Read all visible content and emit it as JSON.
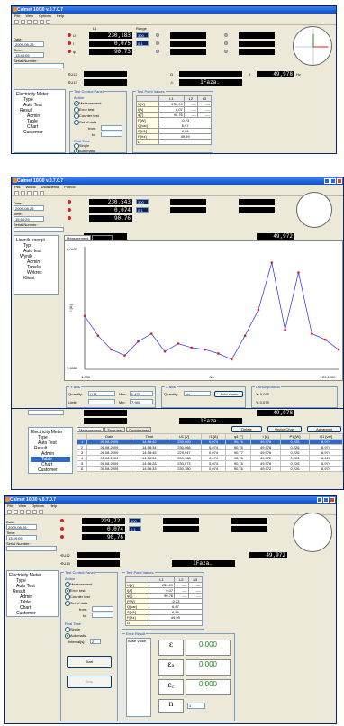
{
  "app": {
    "title": "Calmet 10/30 v.0.7.0.7",
    "menu": [
      "File",
      "View",
      "Options",
      "Help"
    ],
    "menu2": [
      "Plik",
      "Widok",
      "Ustawienia",
      "Pomoc"
    ]
  },
  "left_panel": {
    "date_label": "Date:",
    "date_value": "2009-08-26",
    "time_label": "Time:",
    "time_value": "13:49:05",
    "serial_label": "Serial Number:",
    "serial_value": ""
  },
  "shot2_left": {
    "date_value": "2009-08-26",
    "time_value": "15:54:29"
  },
  "shot4_left": {
    "date_value": "2009-08-26",
    "time_value": "13:49:05"
  },
  "readings1": {
    "range_label": "Range",
    "l1_label": "L1",
    "u_symbol": "U",
    "i_symbol": "I",
    "phi_symbol": "φ",
    "u_value": "230,183",
    "u_range": "300",
    "i_value": "0,075",
    "i_range": "0,1",
    "phi_value": "90,73",
    "phi_unit": "°",
    "u12_label": "∢U12",
    "u13_label": "∢U13",
    "mode_value": "1Faza.",
    "f_label": "f",
    "f_value": "49,978",
    "f_unit": "Hz"
  },
  "readings2": {
    "u_value": "230,543",
    "u_range": "300",
    "i_value": "0,074",
    "i_range": "0,1",
    "phi_value": "90,76",
    "f_value": "49,972"
  },
  "readings3": {
    "mode_value": "1Faza.",
    "f_value": "49,978"
  },
  "readings4": {
    "u_value": "229,721",
    "u_range": "300",
    "i_value": "0,074",
    "i_range": "0,1",
    "phi_value": "90,76",
    "f_value": "49,972",
    "mode_value": "1Faza."
  },
  "tree1": [
    "Electricity Meter",
    "Type",
    "Auto Test",
    "Result",
    "Admin",
    "Table",
    "Chart",
    "Customer"
  ],
  "tree2": [
    "Licznik energii",
    "Typ",
    "Auto test",
    "Wynik",
    "Admin",
    "Tabela",
    "Wykres",
    "Klient"
  ],
  "tree3": [
    "Electricity Meter",
    "Type",
    "Auto Test",
    "Result",
    "Admin",
    "Table",
    "Chart",
    "Customer"
  ],
  "tree4": [
    "Electricity Meter",
    "Type",
    "Auto Test",
    "Result",
    "Admin",
    "Table",
    "Chart",
    "Customer"
  ],
  "control_panel": {
    "title": "Test Control Panel",
    "action_title": "Action",
    "opt_measurement": "Measurement",
    "opt_error_test": "Error test",
    "opt_counter_test": "Counter test",
    "opt_set_data": "Set of data",
    "from_label": "from:",
    "to_label": "to:",
    "realtime_title": "Real Time",
    "opt_single": "Single",
    "opt_automatic": "Automatic",
    "interval_label": "Interval[s]:",
    "interval_value": "2",
    "start_label": "Start",
    "stop_label": "Stop"
  },
  "point_values": {
    "title": "Test Point Values",
    "headers": [
      "",
      "L1",
      "L2",
      "L3"
    ],
    "rows": [
      [
        "U[V]",
        "230,09",
        "----",
        "----"
      ],
      [
        "I[A]",
        "0,07",
        "----",
        "----"
      ],
      [
        "φ[°]",
        "90,76",
        "----",
        "----"
      ],
      [
        "P[W]",
        "-0,23",
        "",
        ""
      ],
      [
        "Q[var]",
        "6,97",
        "",
        ""
      ],
      [
        "S[VA]",
        "6,98",
        "",
        ""
      ],
      [
        "F[Hz]",
        "49,99",
        "",
        ""
      ],
      [
        "Ω",
        "",
        "",
        ""
      ]
    ]
  },
  "point_values4": {
    "rows": [
      [
        "U[V]",
        "230,09",
        "----",
        "----"
      ],
      [
        "I[A]",
        "0,07",
        "----",
        "----"
      ],
      [
        "φ[°]",
        "90,76",
        "----",
        "----"
      ],
      [
        "P[W]",
        "-0,23",
        "",
        ""
      ],
      [
        "Q[var]",
        "6,87",
        "",
        ""
      ],
      [
        "S[VA]",
        "6,88",
        "",
        ""
      ],
      [
        "F[Hz]",
        "49,99",
        "",
        ""
      ],
      [
        "Ω",
        "",
        "",
        ""
      ]
    ]
  },
  "chart_window": {
    "tabs": [
      "Measurement",
      "Error test",
      "Counter test"
    ],
    "y_axis_title": "Y axis",
    "x_axis_title": "X axis",
    "cursor_title": "Cursor position",
    "quantity_label": "Quantity:",
    "quantity_y": "I [A]",
    "quantity_x": "No",
    "limit_label": "Limit:",
    "max_label": "Max:",
    "min_label": "Min:",
    "max_y": "0,433",
    "min_y": "7,981",
    "auto_zoom": "Auto zoom",
    "cursor_x": "X: 0,035",
    "cursor_y": "Y: 0,079"
  },
  "chart_data": {
    "type": "line",
    "title": "",
    "xlabel": "No",
    "ylabel": "I [A]",
    "y_tick_labels": [
      "0,0433",
      "7,9853"
    ],
    "x_tick_labels": [
      "1,000",
      "20,0000"
    ],
    "x": [
      1,
      2,
      3,
      4,
      5,
      6,
      7,
      8,
      9,
      10,
      11,
      12,
      13,
      14,
      15,
      16,
      17,
      18,
      19,
      20
    ],
    "series": [
      {
        "name": "",
        "values": [
          0.0825,
          0.0815,
          0.0808,
          0.0805,
          0.0812,
          0.0816,
          0.0807,
          0.0811,
          0.0809,
          0.0808,
          0.0806,
          0.0803,
          0.0815,
          0.0828,
          0.0852,
          0.0818,
          0.0847,
          0.0816,
          0.0813,
          0.0808
        ]
      }
    ],
    "ylim": [
      0.0798,
      0.086
    ]
  },
  "table_window": {
    "tabs": [
      "Measurement",
      "Error test",
      "Counter test"
    ],
    "delete": "Delete",
    "vector_chart": "Vector Chart",
    "advanced": "Advanced",
    "columns": [
      "",
      "Date",
      "Time",
      "U1 [V]",
      "I1 [A]",
      "φ1 [°]",
      "I [A]",
      "P1 [W]",
      "Q1 [var]"
    ],
    "rows": [
      [
        "1",
        "26.08.2009",
        "14:58:42",
        "230,069",
        "0,074",
        "90,76",
        "49,976",
        "0,226",
        "8,974"
      ],
      [
        "2",
        "26.08.2009",
        "14:58:34",
        "230,066",
        "0,074",
        "90,76",
        "49,976",
        "0,226",
        "8,974"
      ],
      [
        "3",
        "26.08.2009",
        "14:58:45",
        "229,947",
        "0,074",
        "90,77",
        "49,976",
        "0,226",
        "8,974"
      ],
      [
        "4",
        "26.08.2009",
        "14:58:34",
        "230,188",
        "0,074",
        "90,76",
        "49,972",
        "0,226",
        "8,615"
      ],
      [
        "5",
        "26.08.2009",
        "14:58:28",
        "230,073",
        "0,074",
        "90,76",
        "49,976",
        "0,226",
        "8,974"
      ],
      [
        "6",
        "26.08.2009",
        "14:58:33",
        "230,180",
        "0,074",
        "90,76",
        "49,972",
        "0,226",
        "8,974"
      ]
    ]
  },
  "error_result": {
    "title": "Error Result",
    "base_value_label": "Base Value",
    "eps_values": [
      "0,000",
      "0,000",
      "0,000"
    ],
    "n_label": "n",
    "n_value": "1"
  }
}
